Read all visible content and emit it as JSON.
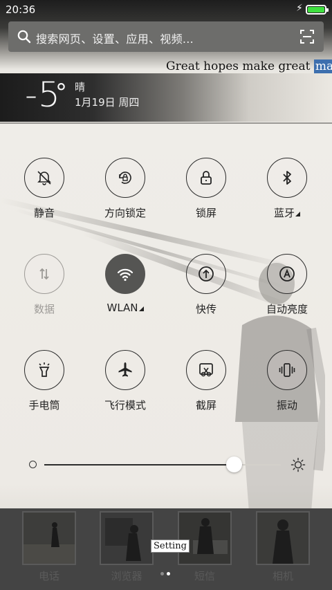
{
  "status_bar": {
    "time": "20:36",
    "battery_color": "#3fe03f"
  },
  "search": {
    "placeholder": "搜索网页、设置、应用、视频..."
  },
  "quote": {
    "text": "Great hopes make great ",
    "highlight": "man",
    "end": "."
  },
  "weather": {
    "temperature": "-5",
    "degree": "°",
    "condition": "晴",
    "date": "1月19日 周四"
  },
  "toggles": [
    {
      "label": "静音",
      "icon": "bell-off-icon",
      "state": "off"
    },
    {
      "label": "方向锁定",
      "icon": "rotation-lock-icon",
      "state": "off"
    },
    {
      "label": "锁屏",
      "icon": "lock-icon",
      "state": "off"
    },
    {
      "label": "蓝牙",
      "icon": "bluetooth-icon",
      "state": "off"
    },
    {
      "label": "数据",
      "icon": "mobile-data-icon",
      "state": "disabled"
    },
    {
      "label": "WLAN",
      "icon": "wifi-icon",
      "state": "on"
    },
    {
      "label": "快传",
      "icon": "quick-transfer-icon",
      "state": "off"
    },
    {
      "label": "自动亮度",
      "icon": "auto-brightness-icon",
      "state": "off"
    },
    {
      "label": "手电筒",
      "icon": "flashlight-icon",
      "state": "off"
    },
    {
      "label": "飞行模式",
      "icon": "airplane-icon",
      "state": "off"
    },
    {
      "label": "截屏",
      "icon": "screenshot-icon",
      "state": "off"
    },
    {
      "label": "振动",
      "icon": "vibrate-icon",
      "state": "off"
    }
  ],
  "brightness": {
    "level": 0.8
  },
  "dock": {
    "apps": [
      {
        "label": "电话"
      },
      {
        "label": "浏览器"
      },
      {
        "label": "短信"
      },
      {
        "label": "相机"
      }
    ],
    "tooltip": "Setting",
    "page_count": 2,
    "active_page": 2
  },
  "colors": {
    "accent_highlight": "#3d6fae",
    "active_toggle": "#555553"
  }
}
